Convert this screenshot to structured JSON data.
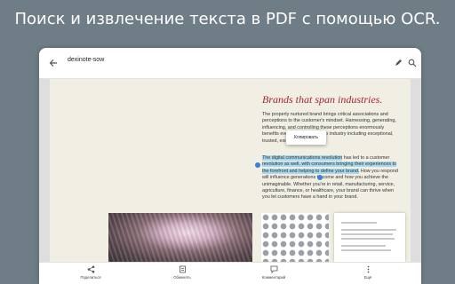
{
  "headline": "Поиск и извлечение текста в PDF с помощью OCR.",
  "toolbar": {
    "title": "dexinote-sow",
    "back_icon": "arrow-left-icon",
    "edit_icon": "pencil-icon",
    "search_icon": "search-icon"
  },
  "document": {
    "heading": "Brands that span industries.",
    "paragraph1": "The properly nurtured brand brings critical associations and perceptions to the customer's mindset. Harnessing, generating, influencing, and controlling these perceptions enormously benefits every top attribute app industry including exceptional, trusted, exciting, and reliable.",
    "p2_highlight1": "The digital communications revolution",
    "p2_plain1": " has led to a customer ",
    "p2_highlight2": "revolution as well, with consumers bringing their experiences to the forefront and helping to define your brand.",
    "p2_rest": " How you respond will influence generations to come and how you achieve the unimaginable. Whether you're in retail, manufacturing, service, agriculture, finance, or healthcare, your brand can thrive when you let customers have a hand in your brand.",
    "popup_label": "Копировать"
  },
  "bottom_bar": [
    {
      "label": "Поделиться",
      "icon": "share-icon"
    },
    {
      "label": "Обменять",
      "icon": "exchange-icon"
    },
    {
      "label": "Комментарий",
      "icon": "comment-icon"
    },
    {
      "label": "Ещё",
      "icon": "more-icon"
    }
  ],
  "colors": {
    "background": "#6f7e86",
    "heading": "#a6262e",
    "highlight": "#a9d8ec",
    "selection_handle": "#3b7fd9"
  }
}
